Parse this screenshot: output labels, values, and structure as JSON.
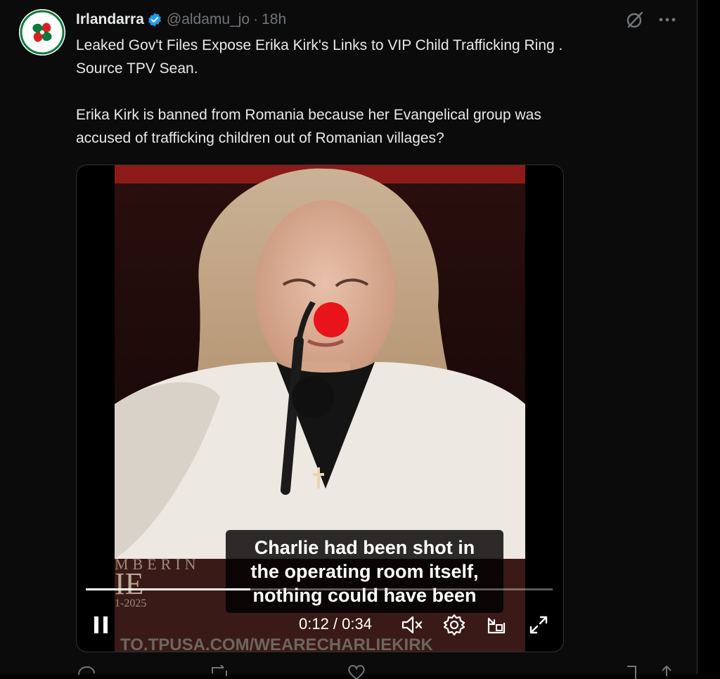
{
  "tweet": {
    "author_name": "Irlandarra",
    "handle": "@aldamu_jo",
    "separator": "·",
    "time": "18h",
    "text": "Leaked Gov't Files Expose Erika Kirk's Links to VIP Child Trafficking Ring .\nSource TPV Sean.\n\nErika Kirk is banned from Romania because her Evangelical group was\naccused of trafficking children out of Romanian villages?",
    "icons": {
      "avatar": "lauburu-avatar",
      "verified": "verified-badge-icon",
      "grok": "grok-icon",
      "more": "more-icon"
    }
  },
  "video": {
    "caption_lines": [
      "Charlie had been shot in",
      "the operating room itself,",
      "nothing could have been"
    ],
    "time_display": "0:12 / 0:34",
    "progress": 0.3529,
    "backdrop_text": "TO.TPUSA.COM/WEARECHARLIEKIRK",
    "banner_partial_1": "MBERIN",
    "banner_partial_2": "IE",
    "banner_partial_3": "1-2025",
    "controls": [
      "pause-icon",
      "mute-icon",
      "settings-icon",
      "pip-icon",
      "fullscreen-icon"
    ]
  },
  "colors": {
    "background": "#0b0b0b",
    "text": "#e7e9ea",
    "secondary": "#71767b",
    "verified": "#1d9bf0",
    "red_dot": "#e8141a"
  }
}
